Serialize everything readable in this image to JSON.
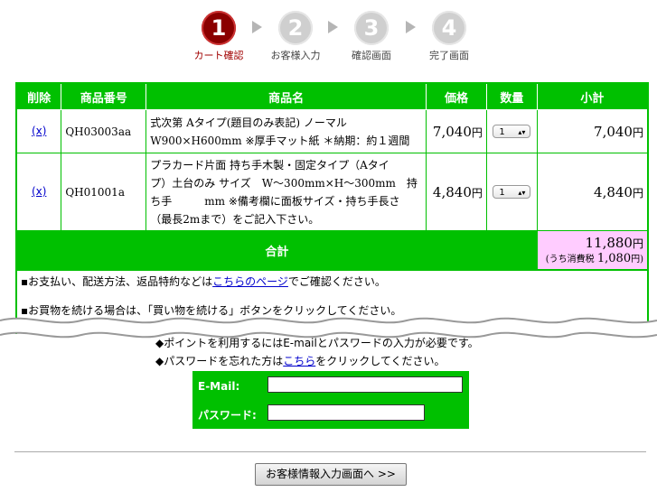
{
  "steps": [
    {
      "num": "1",
      "label": "カート確認"
    },
    {
      "num": "2",
      "label": "お客様入力"
    },
    {
      "num": "3",
      "label": "確認画面"
    },
    {
      "num": "4",
      "label": "完了画面"
    }
  ],
  "table": {
    "headers": [
      "削除",
      "商品番号",
      "商品名",
      "価格",
      "数量",
      "小計"
    ],
    "rows": [
      {
        "delete": "(x)",
        "code": "QH03003aa",
        "name_lines": [
          "式次第 Aタイプ(題目のみ表記) ノーマル",
          "W900×H600mm ※厚手マット紙 ＊納期：約１週間"
        ],
        "price": "7,040",
        "qty": "1",
        "subtotal": "7,040"
      },
      {
        "delete": "(x)",
        "code": "QH01001a",
        "name_lines": [
          "プラカード片面 持ち手木製・固定タイプ（Aタイ",
          "プ）土台のみ サイズ　W〜300mm×H〜300mm　持",
          "ち手　　　mm ※備考欄に面板サイズ・持ち手長さ",
          "（最長2mまで）をご記入下さい。"
        ],
        "price": "4,840",
        "qty": "1",
        "subtotal": "4,840"
      }
    ],
    "yen": "円",
    "total_label": "合計",
    "total_value": "11,880",
    "tax_note_prefix": "(うち消費税",
    "tax_value": "1,080",
    "tax_note_suffix": "円)"
  },
  "notes": {
    "n1_prefix": "▪お支払い、配送方法、返品特約などは",
    "n1_link": "こちらのページ",
    "n1_suffix": "でご確認ください。",
    "n2": "▪お買物を続ける場合は、「買い物を続ける」ボタンをクリックしてください。"
  },
  "hints": {
    "h1": "◆ポイントを利用するにはE-mailとパスワードの入力が必要です。",
    "h2_prefix": "◆パスワードを忘れた方は",
    "h2_link": "こちら",
    "h2_suffix": "をクリックしてください。"
  },
  "login": {
    "email_label": "E-Mail:",
    "email_value": "",
    "password_label": "パスワード:",
    "password_value": ""
  },
  "next_button": "お客様情報入力画面へ >>",
  "colors": {
    "green": "#00c000",
    "active_step": "#8b0000",
    "total_bg": "#ffccff"
  }
}
